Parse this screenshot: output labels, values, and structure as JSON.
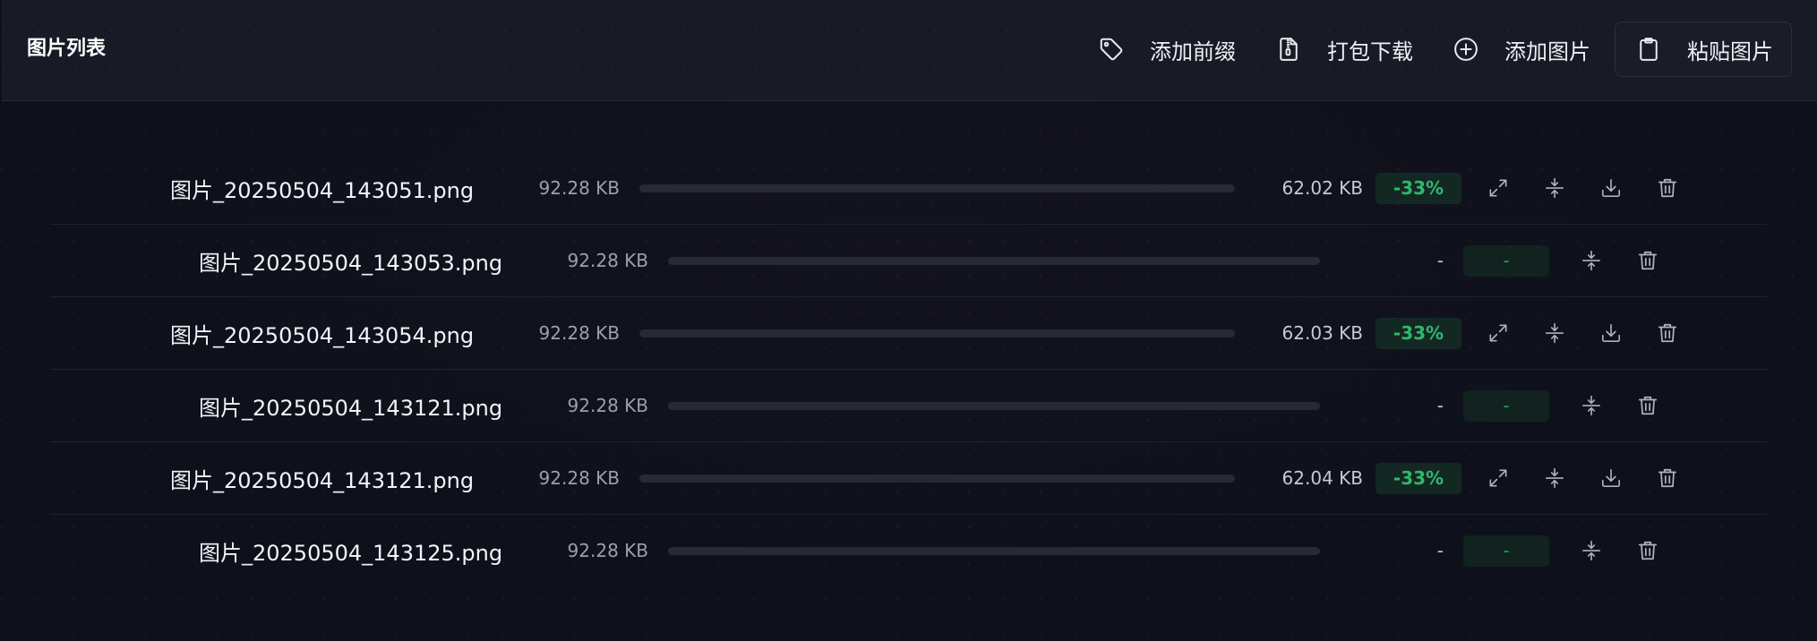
{
  "header": {
    "title": "图片列表",
    "buttons": {
      "add_prefix": "添加前缀",
      "download_zip": "打包下载",
      "add_image": "添加图片",
      "paste_image": "粘贴图片"
    }
  },
  "colors": {
    "background": "#0e111b",
    "header_bg": "#181b26",
    "success_green": "#2fb86c",
    "badge_bg": "#142823",
    "progress_track": "#262a35"
  },
  "files": [
    {
      "name": "图片_20250504_143051.png",
      "original_size": "92.28 KB",
      "compressed_size": "62.02 KB",
      "ratio": "-33%"
    },
    {
      "name": "图片_20250504_143053.png",
      "original_size": "92.28 KB",
      "compressed_size": "-",
      "ratio": "-"
    },
    {
      "name": "图片_20250504_143054.png",
      "original_size": "92.28 KB",
      "compressed_size": "62.03 KB",
      "ratio": "-33%"
    },
    {
      "name": "图片_20250504_143121.png",
      "original_size": "92.28 KB",
      "compressed_size": "-",
      "ratio": "-"
    },
    {
      "name": "图片_20250504_143121.png",
      "original_size": "92.28 KB",
      "compressed_size": "62.04 KB",
      "ratio": "-33%"
    },
    {
      "name": "图片_20250504_143125.png",
      "original_size": "92.28 KB",
      "compressed_size": "-",
      "ratio": "-"
    }
  ],
  "row_actions": [
    "expand-icon",
    "compress-icon",
    "download-icon",
    "trash-icon"
  ]
}
